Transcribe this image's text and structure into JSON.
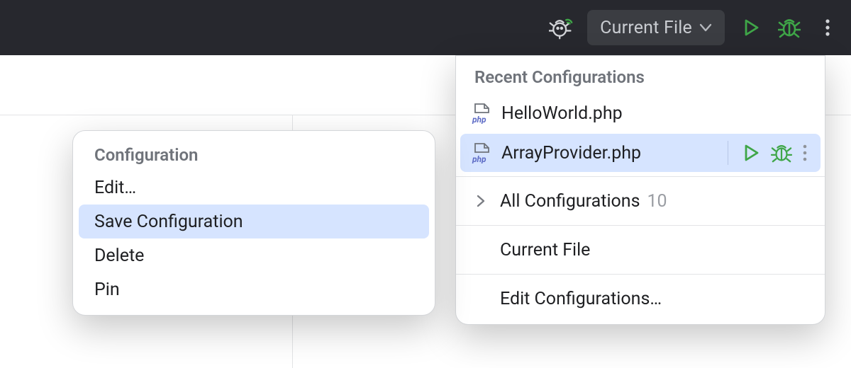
{
  "toolbar": {
    "selector_label": "Current File"
  },
  "panel": {
    "title": "Recent Configurations",
    "items": [
      {
        "name": "HelloWorld.php"
      },
      {
        "name": "ArrayProvider.php"
      }
    ],
    "all_label": "All Configurations",
    "all_count": "10",
    "current_file_label": "Current File",
    "edit_label": "Edit Configurations…"
  },
  "submenu": {
    "title": "Configuration",
    "items": [
      "Edit…",
      "Save Configuration",
      "Delete",
      "Pin"
    ]
  },
  "colors": {
    "accent_green": "#3fa648",
    "highlight_blue": "#d6e4ff",
    "php_blue": "#5f6dc6"
  }
}
